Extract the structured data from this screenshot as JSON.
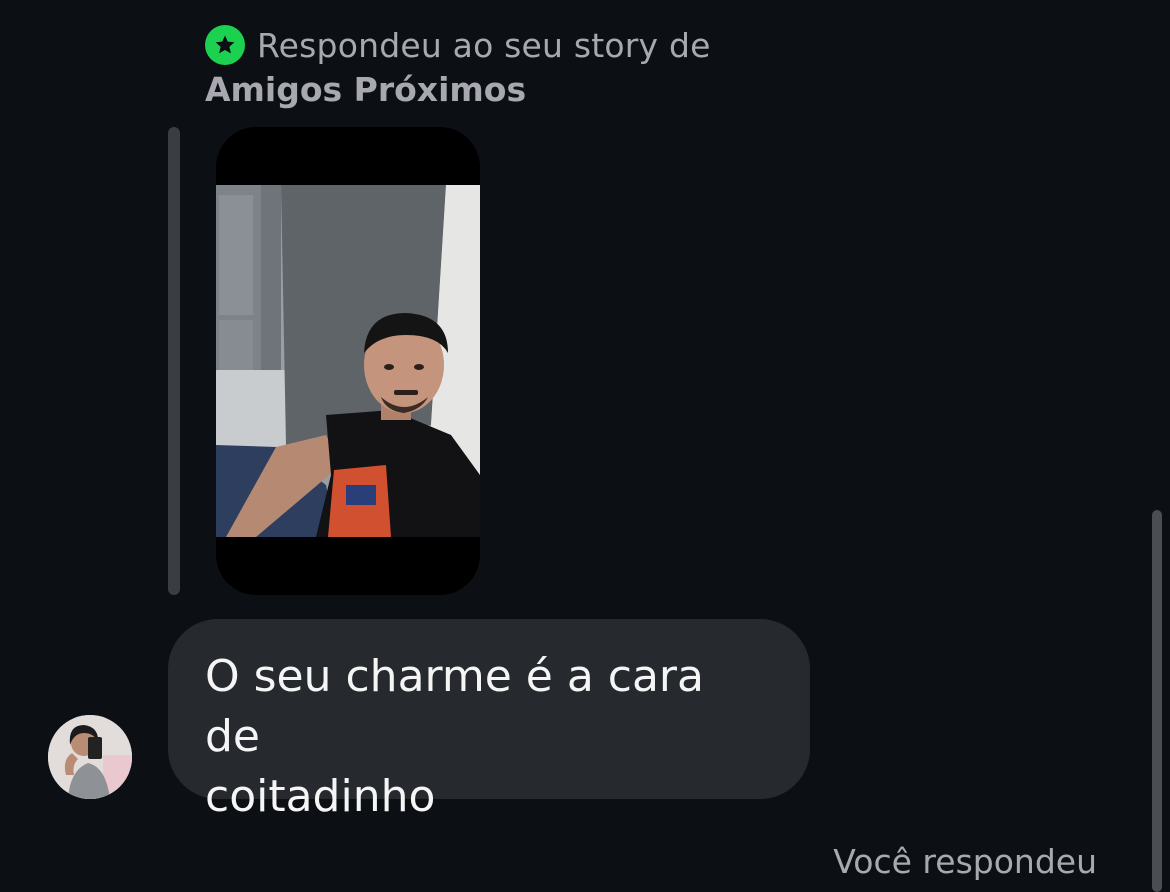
{
  "story_reply": {
    "line1": "Respondeu ao seu story de",
    "line2": "Amigos Próximos",
    "badge_icon": "star-icon",
    "badge_color": "#1cd14f"
  },
  "story_card": {
    "image_description_icon": "story-photo"
  },
  "message": {
    "text": "O seu charme é a cara de\ncoitadinho",
    "bubble_color": "#262a2f"
  },
  "sender": {
    "avatar_icon": "avatar-icon"
  },
  "footer": {
    "you_replied": "Você respondeu"
  },
  "colors": {
    "background": "#0c1014",
    "muted_text": "#a8a8b0",
    "primary_text": "#f5f5f5"
  }
}
